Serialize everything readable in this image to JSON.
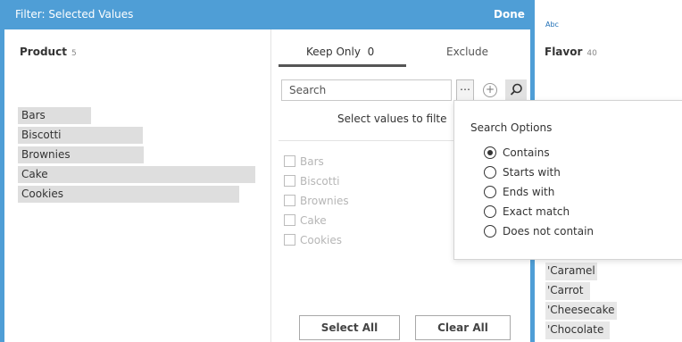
{
  "dialog": {
    "title": "Filter: Selected Values",
    "done_label": "Done",
    "accent_color": "#4f9ed6"
  },
  "product_pane": {
    "title": "Product",
    "count": "5",
    "items": [
      "Bars",
      "Biscotti",
      "Brownies",
      "Cake",
      "Cookies"
    ]
  },
  "value_pane": {
    "tabs": [
      {
        "label": "Keep Only",
        "count": "0",
        "selected": true
      },
      {
        "label": "Exclude",
        "selected": false
      }
    ],
    "search": {
      "placeholder": "Search"
    },
    "more_icon": "ellipsis-icon",
    "add_icon": "plus-circle-icon",
    "search_icon": "magnifier-icon",
    "helper_text": "Select values to filte",
    "values": [
      "Bars",
      "Biscotti",
      "Brownies",
      "Cake",
      "Cookies"
    ],
    "select_all_label": "Select All",
    "clear_all_label": "Clear All"
  },
  "flavor_pane": {
    "type_label": "Abc",
    "title": "Flavor",
    "count": "40",
    "items": [
      "'Caramel",
      "'Carrot",
      "'Cheesecake",
      "'Chocolate"
    ]
  },
  "search_options": {
    "title": "Search Options",
    "options": [
      {
        "label": "Contains",
        "selected": true
      },
      {
        "label": "Starts with",
        "selected": false
      },
      {
        "label": "Ends with",
        "selected": false
      },
      {
        "label": "Exact match",
        "selected": false
      },
      {
        "label": "Does not contain",
        "selected": false
      }
    ]
  }
}
